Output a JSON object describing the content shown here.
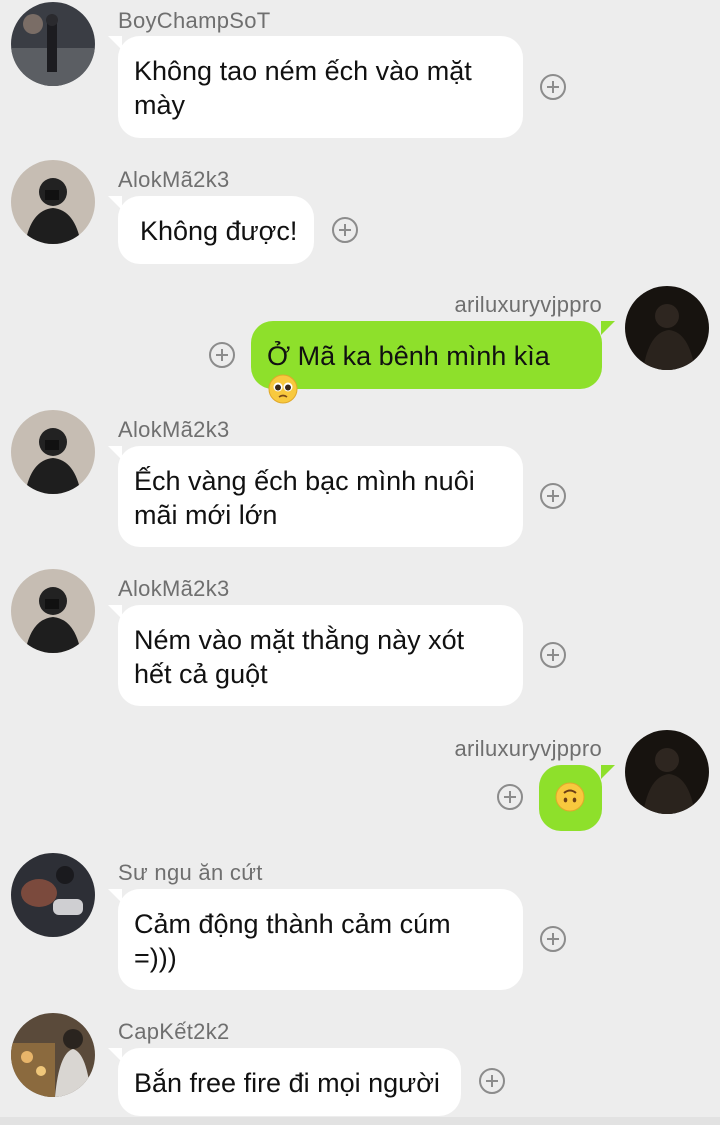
{
  "colors": {
    "background": "#ededed",
    "outgoing_bubble": "#8ee02b",
    "incoming_bubble": "#ffffff"
  },
  "messages": [
    {
      "sender": "BoyChampSoT",
      "side": "left",
      "lines": [
        "Không tao ném ếch vào mặt",
        "mày"
      ]
    },
    {
      "sender": "AlokMã2k3",
      "side": "left",
      "lines": [
        "Không được!"
      ]
    },
    {
      "sender": "ariluxuryvjppro",
      "side": "right",
      "text": "Ở Mã ka bênh mình kìa",
      "emoji": "pleading-face"
    },
    {
      "sender": "AlokMã2k3",
      "side": "left",
      "lines": [
        "Ếch vàng ếch bạc mình nuôi",
        "mãi mới lớn"
      ]
    },
    {
      "sender": "AlokMã2k3",
      "side": "left",
      "lines": [
        "Ném vào mặt thằng này xót",
        "hết cả guột"
      ]
    },
    {
      "sender": "ariluxuryvjppro",
      "side": "right",
      "emoji": "upside-down-face"
    },
    {
      "sender": "Sư ngu ăn cứt",
      "side": "left",
      "lines": [
        "Cảm động thành cảm cúm",
        "=)))"
      ]
    },
    {
      "sender": "CapKết2k2",
      "side": "left",
      "lines": [
        "Bắn free fire đi mọi người"
      ]
    }
  ]
}
